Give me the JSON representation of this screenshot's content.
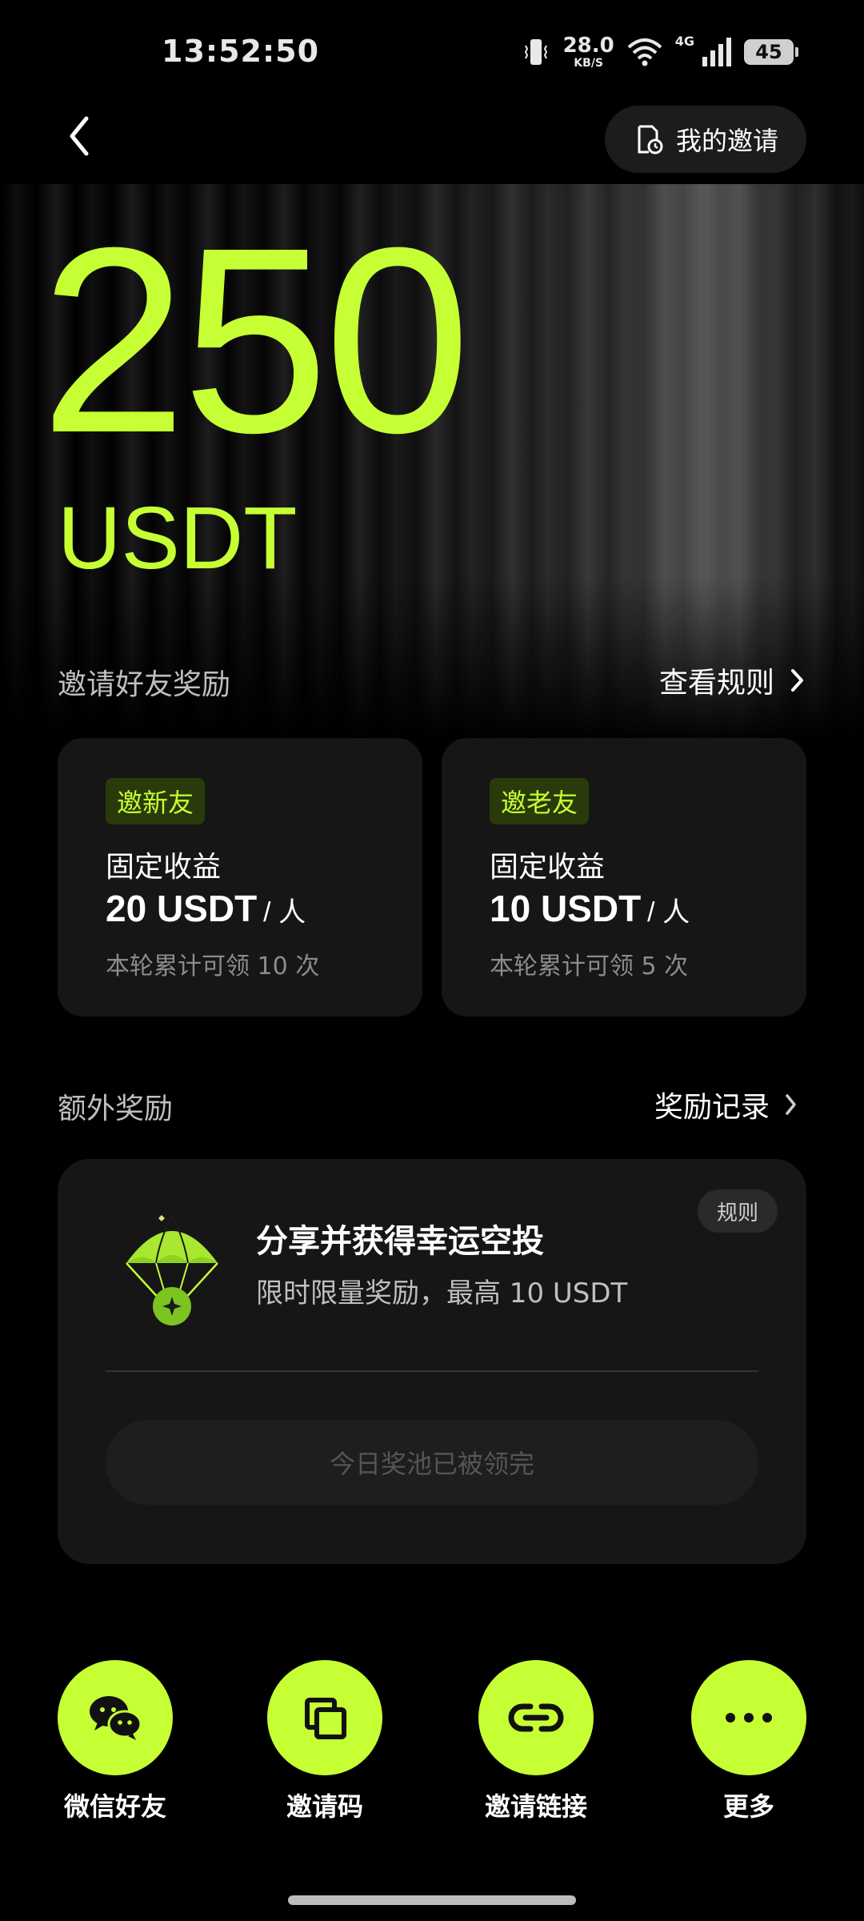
{
  "status_bar": {
    "time": "13:52:50",
    "net_speed": "28.0",
    "net_unit": "KB/S",
    "net_type": "4G",
    "battery": "45"
  },
  "header": {
    "invite_button_label": "我的邀请"
  },
  "hero": {
    "amount": "250",
    "currency": "USDT"
  },
  "invite_section": {
    "title": "邀请好友奖励",
    "rules_link": "查看规则",
    "cards": [
      {
        "tag": "邀新友",
        "label": "固定收益",
        "value": "20 USDT",
        "per": "/ 人",
        "note": "本轮累计可领 10 次"
      },
      {
        "tag": "邀老友",
        "label": "固定收益",
        "value": "10 USDT",
        "per": "/ 人",
        "note": "本轮累计可领 5 次"
      }
    ]
  },
  "extra_section": {
    "title": "额外奖励",
    "records_link": "奖励记录",
    "card": {
      "rules_label": "规则",
      "title": "分享并获得幸运空投",
      "subtitle": "限时限量奖励，最高 10 USDT",
      "button_label": "今日奖池已被领完"
    }
  },
  "share_options": [
    {
      "label": "微信好友",
      "icon": "wechat-icon"
    },
    {
      "label": "邀请码",
      "icon": "copy-icon"
    },
    {
      "label": "邀请链接",
      "icon": "link-icon"
    },
    {
      "label": "更多",
      "icon": "more-icon"
    }
  ],
  "colors": {
    "accent": "#c6ff33",
    "background": "#000000",
    "card": "#161616"
  }
}
